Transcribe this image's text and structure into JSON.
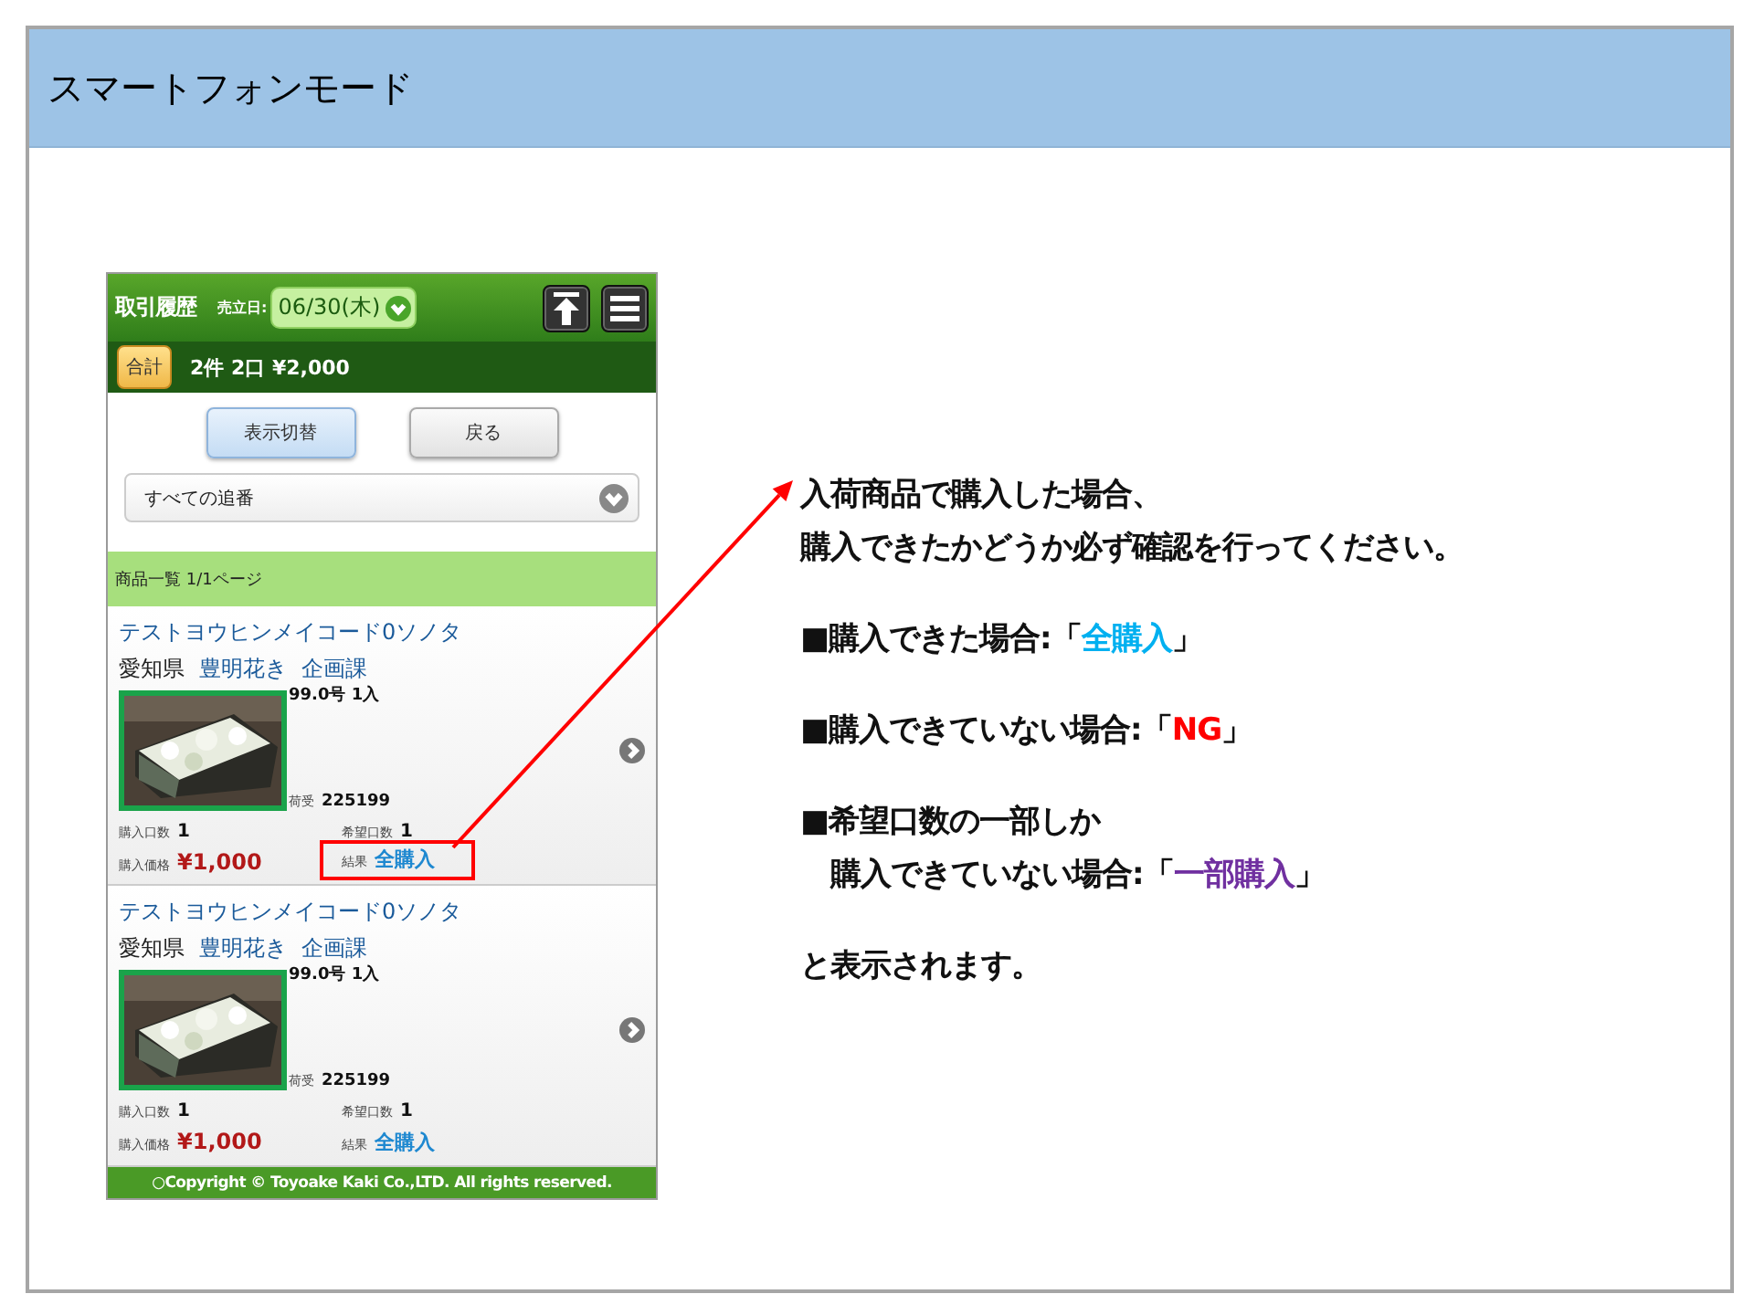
{
  "slide": {
    "title": "スマートフォンモード"
  },
  "phone": {
    "header": {
      "title": "取引履歴",
      "date_label": "売立日:",
      "date": "06/30(木)"
    },
    "summary": {
      "badge": "合計",
      "text": "2件 2口 ¥2,000"
    },
    "buttons": [
      {
        "label": "表示切替",
        "selected": true
      },
      {
        "label": "戻る",
        "selected": false
      }
    ],
    "filter": {
      "value": "すべての追番"
    },
    "list_header": "商品一覧 1/1ページ",
    "items": [
      {
        "name": "テストヨウヒンメイコード0ソノタ",
        "prefecture": "愛知県",
        "shipper": "豊明花き",
        "department": "企画課",
        "spec": "99.0号 1入",
        "lot_label": "荷受",
        "lot": "225199",
        "qty_label": "購入口数",
        "qty": "1",
        "wish_label": "希望口数",
        "wish": "1",
        "price_label": "購入価格",
        "price": "¥1,000",
        "result_label": "結果",
        "result": "全購入",
        "highlighted": true
      },
      {
        "name": "テストヨウヒンメイコード0ソノタ",
        "prefecture": "愛知県",
        "shipper": "豊明花き",
        "department": "企画課",
        "spec": "99.0号 1入",
        "lot_label": "荷受",
        "lot": "225199",
        "qty_label": "購入口数",
        "qty": "1",
        "wish_label": "希望口数",
        "wish": "1",
        "price_label": "購入価格",
        "price": "¥1,000",
        "result_label": "結果",
        "result": "全購入",
        "highlighted": false
      }
    ],
    "footer": "○Copyright © Toyoake Kaki Co.,LTD. All rights reserved."
  },
  "callout": {
    "paragraphs": [
      {
        "lines": [
          {
            "parts": [
              {
                "text": "入荷商品で購入した場合、"
              }
            ]
          },
          {
            "parts": [
              {
                "text": "購入できたかどうか必ず確認を行ってください。"
              }
            ]
          }
        ]
      },
      {
        "lines": [
          {
            "parts": [
              {
                "text": "■購入できた場合:「"
              },
              {
                "text": "全購入",
                "color": "#00b0f0"
              },
              {
                "text": "」"
              }
            ]
          }
        ]
      },
      {
        "lines": [
          {
            "parts": [
              {
                "text": "■購入できていない場合:「"
              },
              {
                "text": "NG",
                "color": "#ff0000"
              },
              {
                "text": "」"
              }
            ]
          }
        ]
      },
      {
        "lines": [
          {
            "parts": [
              {
                "text": "■希望口数の一部しか"
              }
            ]
          },
          {
            "parts": [
              {
                "text": "　購入できていない場合:「"
              },
              {
                "text": "一部購入",
                "color": "#7030a0"
              },
              {
                "text": "」"
              }
            ]
          }
        ]
      },
      {
        "lines": [
          {
            "parts": [
              {
                "text": "と表示されます。"
              }
            ]
          }
        ]
      }
    ]
  }
}
